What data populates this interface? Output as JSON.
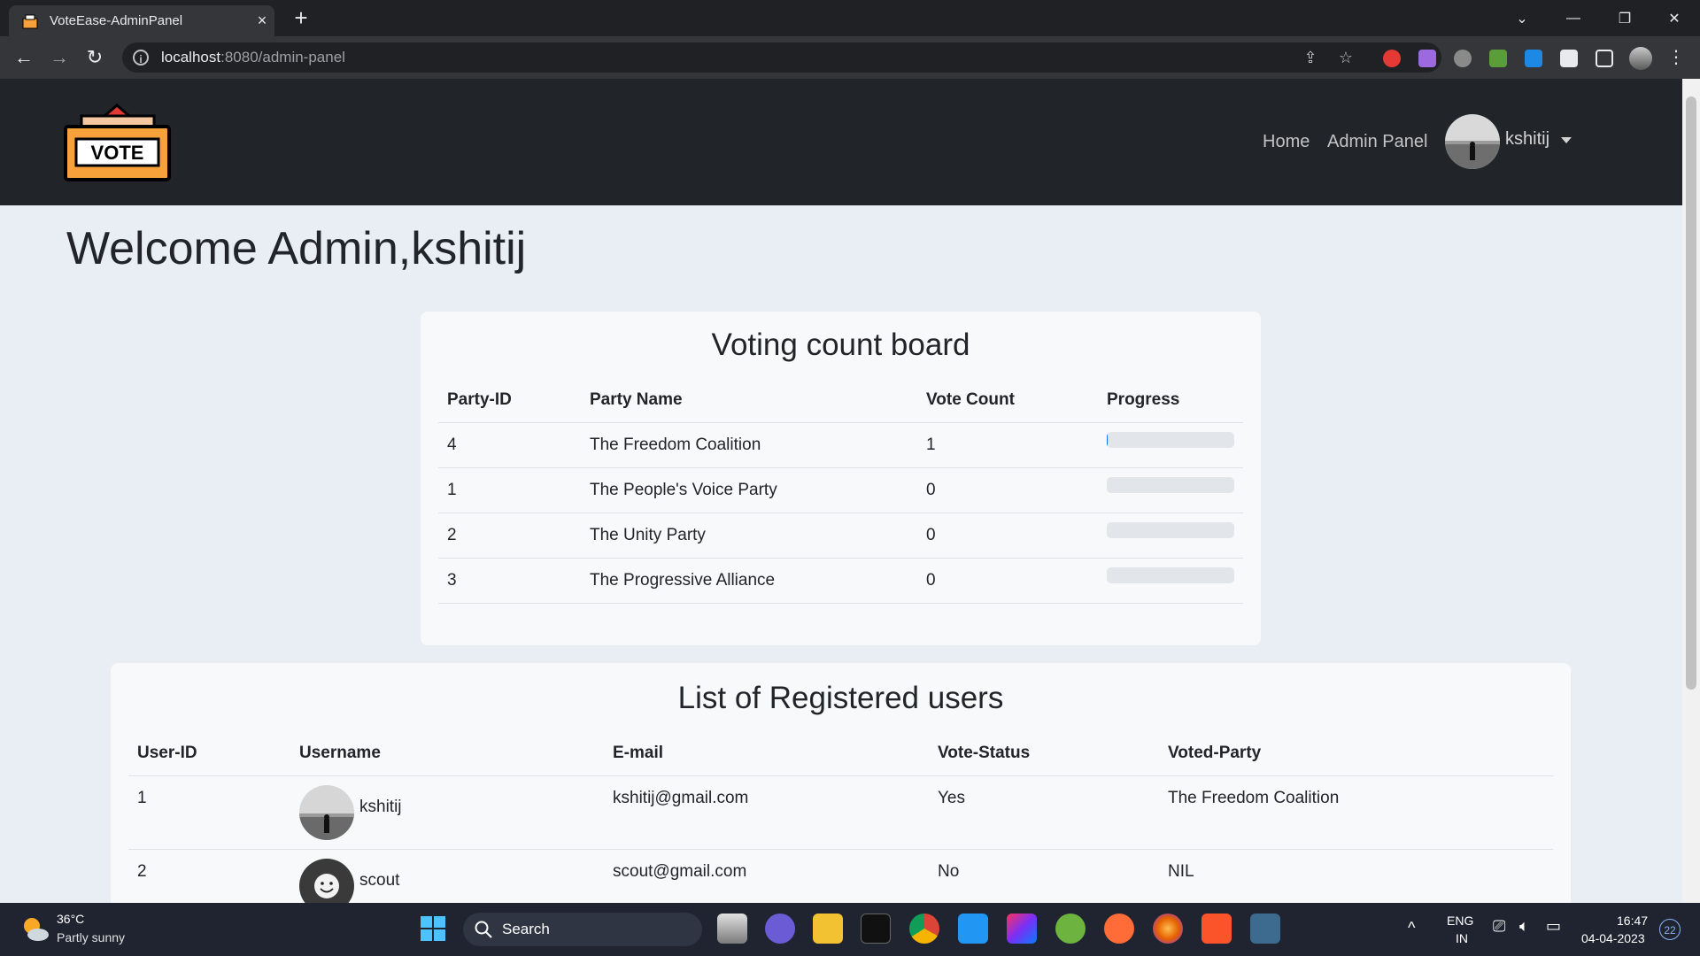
{
  "browser": {
    "tab_title": "VoteEase-AdminPanel",
    "tab_close": "×",
    "new_tab": "+",
    "url_host": "localhost",
    "url_path": ":8080/admin-panel"
  },
  "navbar": {
    "logo_text": "VOTE",
    "links": [
      "Home",
      "Admin Panel"
    ],
    "username": "kshitij"
  },
  "welcome": "Welcome Admin,kshitij",
  "voting_board": {
    "title": "Voting count board",
    "headers": [
      "Party-ID",
      "Party Name",
      "Vote Count",
      "Progress"
    ],
    "rows": [
      {
        "id": "4",
        "name": "The Freedom Coalition",
        "count": "1",
        "progress": 1
      },
      {
        "id": "1",
        "name": "The People's Voice Party",
        "count": "0",
        "progress": 0
      },
      {
        "id": "2",
        "name": "The Unity Party",
        "count": "0",
        "progress": 0
      },
      {
        "id": "3",
        "name": "The Progressive Alliance",
        "count": "0",
        "progress": 0
      }
    ]
  },
  "users_list": {
    "title": "List of Registered users",
    "headers": [
      "User-ID",
      "Username",
      "E-mail",
      "Vote-Status",
      "Voted-Party"
    ],
    "rows": [
      {
        "id": "1",
        "username": "kshitij",
        "email": "kshitij@gmail.com",
        "status": "Yes",
        "party": "The Freedom Coalition"
      },
      {
        "id": "2",
        "username": "scout",
        "email": "scout@gmail.com",
        "status": "No",
        "party": "NIL"
      }
    ]
  },
  "taskbar": {
    "temperature": "36°C",
    "condition": "Partly sunny",
    "search_label": "Search",
    "lang_top": "ENG",
    "lang_bottom": "IN",
    "time": "16:47",
    "date": "04-04-2023",
    "notifications": "22"
  },
  "colors": {
    "navbar": "#212529",
    "page_bg": "#e9edf4",
    "card_bg": "#f8f9fa",
    "progress_fill": "#0d6efd",
    "logo_orange": "#f7a13b"
  }
}
